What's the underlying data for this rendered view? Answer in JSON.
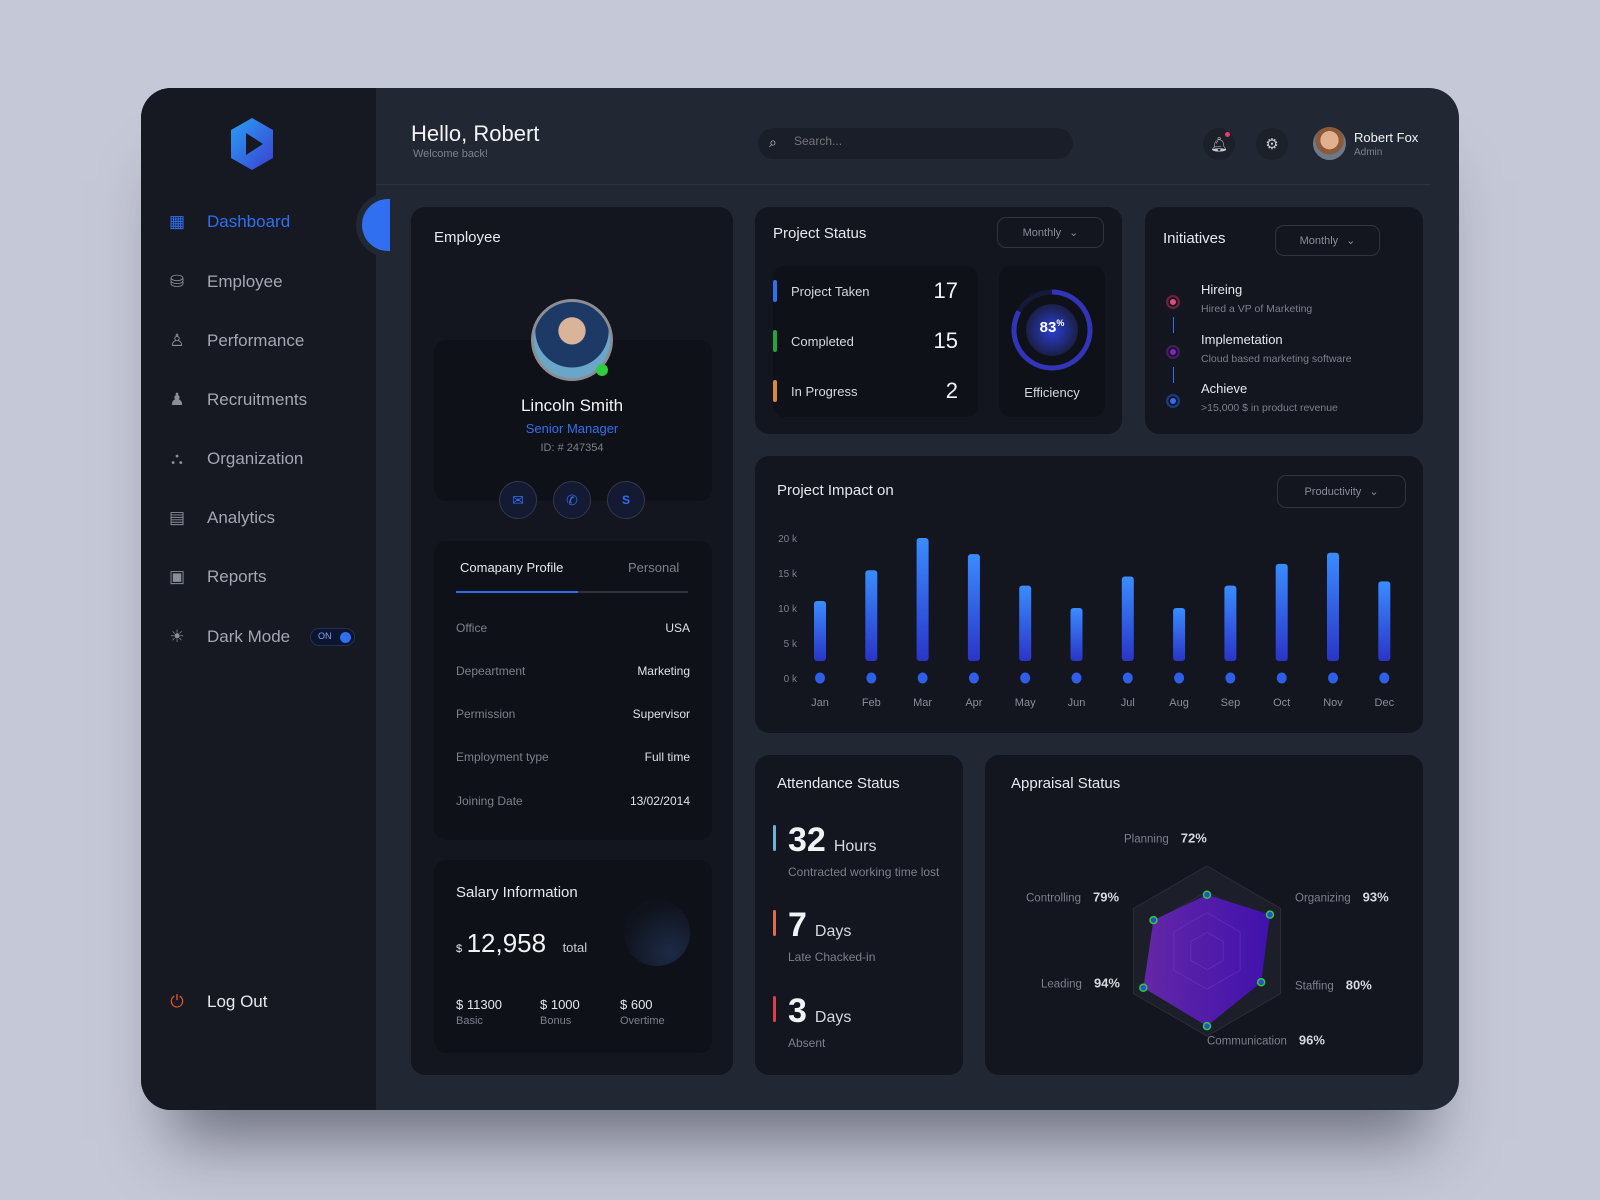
{
  "colors": {
    "accent": "#2f6ff0",
    "card": "#13151f",
    "bg": "#222833",
    "radar_fill": "#5a1fb8",
    "dot_border": "#2ecc40"
  },
  "sidebar": {
    "logo": "play-hexagon-logo",
    "items": [
      {
        "label": "Dashboard",
        "icon": "grid-icon",
        "active": true
      },
      {
        "label": "Employee",
        "icon": "employee-icon"
      },
      {
        "label": "Performance",
        "icon": "performance-icon"
      },
      {
        "label": "Recruitments",
        "icon": "recruitments-icon"
      },
      {
        "label": "Organization",
        "icon": "organization-icon"
      },
      {
        "label": "Analytics",
        "icon": "analytics-icon"
      },
      {
        "label": "Reports",
        "icon": "reports-icon"
      },
      {
        "label": "Dark Mode",
        "icon": "sun-icon"
      }
    ],
    "dark_mode_toggle": "ON",
    "logout": "Log Out"
  },
  "header": {
    "greeting": "Hello, Robert",
    "subtitle": "Welcome back!",
    "search_placeholder": "Search...",
    "user": {
      "name": "Robert Fox",
      "role": "Admin"
    }
  },
  "employee": {
    "title": "Employee",
    "name": "Lincoln Smith",
    "position": "Senior Manager",
    "id": "ID:  # 247354",
    "tabs": [
      "Comapany Profile",
      "Personal"
    ],
    "rows": [
      {
        "k": "Office",
        "v": "USA"
      },
      {
        "k": "Depeartment",
        "v": "Marketing"
      },
      {
        "k": "Permission",
        "v": "Supervisor"
      },
      {
        "k": "Employment type",
        "v": "Full time"
      },
      {
        "k": "Joining Date",
        "v": "13/02/2014"
      }
    ],
    "salary": {
      "title": "Salary Information",
      "currency": "$",
      "total": "12,958",
      "total_label": "total",
      "items": [
        {
          "v": "$ 11300",
          "k": "Basic"
        },
        {
          "v": "$ 1000",
          "k": "Bonus"
        },
        {
          "v": "$ 600",
          "k": "Overtime"
        }
      ]
    }
  },
  "project_status": {
    "title": "Project Status",
    "filter": "Monthly",
    "rows": [
      {
        "label": "Project Taken",
        "value": "17",
        "color": "#2f6ff0"
      },
      {
        "label": "Completed",
        "value": "15",
        "color": "#22a53a"
      },
      {
        "label": "In Progress",
        "value": "2",
        "color": "#d98a3a"
      }
    ],
    "efficiency": {
      "value": "83",
      "unit": "%",
      "label": "Efficiency",
      "percent": 83
    }
  },
  "initiatives": {
    "title": "Initiatives",
    "filter": "Monthly",
    "items": [
      {
        "title": "Hireing",
        "sub": "Hired a VP of Marketing",
        "color": "#e0507a"
      },
      {
        "title": "Implemetation",
        "sub": "Cloud based marketing software",
        "color": "#8a1fc8"
      },
      {
        "title": "Achieve",
        "sub": ">15,000 $ in product revenue",
        "color": "#2f6ff0"
      }
    ]
  },
  "impact": {
    "title": "Project Impact on",
    "filter": "Productivity"
  },
  "chart_data": {
    "type": "bar",
    "categories": [
      "Jan",
      "Feb",
      "Mar",
      "Apr",
      "May",
      "Jun",
      "Jul",
      "Aug",
      "Sep",
      "Oct",
      "Nov",
      "Dec"
    ],
    "values": [
      11,
      15.4,
      20,
      17.7,
      13.2,
      10,
      14.5,
      10,
      13.2,
      16.3,
      17.9,
      13.8
    ],
    "yticks": [
      "0 k",
      "5 k",
      "10 k",
      "15 k",
      "20 k"
    ],
    "ylim": [
      0,
      20
    ],
    "unit": "k",
    "grid": false
  },
  "attendance": {
    "title": "Attendance Status",
    "items": [
      {
        "value": "32",
        "unit": "Hours",
        "sub": "Contracted working time lost",
        "color": "#6fb0d8"
      },
      {
        "value": "7",
        "unit": "Days",
        "sub": "Late Chacked-in",
        "color": "#d9704a"
      },
      {
        "value": "3",
        "unit": "Days",
        "sub": "Absent",
        "color": "#d9404a"
      }
    ]
  },
  "appraisal": {
    "title": "Appraisal Status",
    "axes": [
      {
        "label": "Planning",
        "value": "72%",
        "pct": 72
      },
      {
        "label": "Organizing",
        "value": "93%",
        "pct": 93
      },
      {
        "label": "Staffing",
        "value": "80%",
        "pct": 80
      },
      {
        "label": "Communication",
        "value": "96%",
        "pct": 96
      },
      {
        "label": "Leading",
        "value": "94%",
        "pct": 94
      },
      {
        "label": "Controlling",
        "value": "79%",
        "pct": 79
      }
    ]
  }
}
